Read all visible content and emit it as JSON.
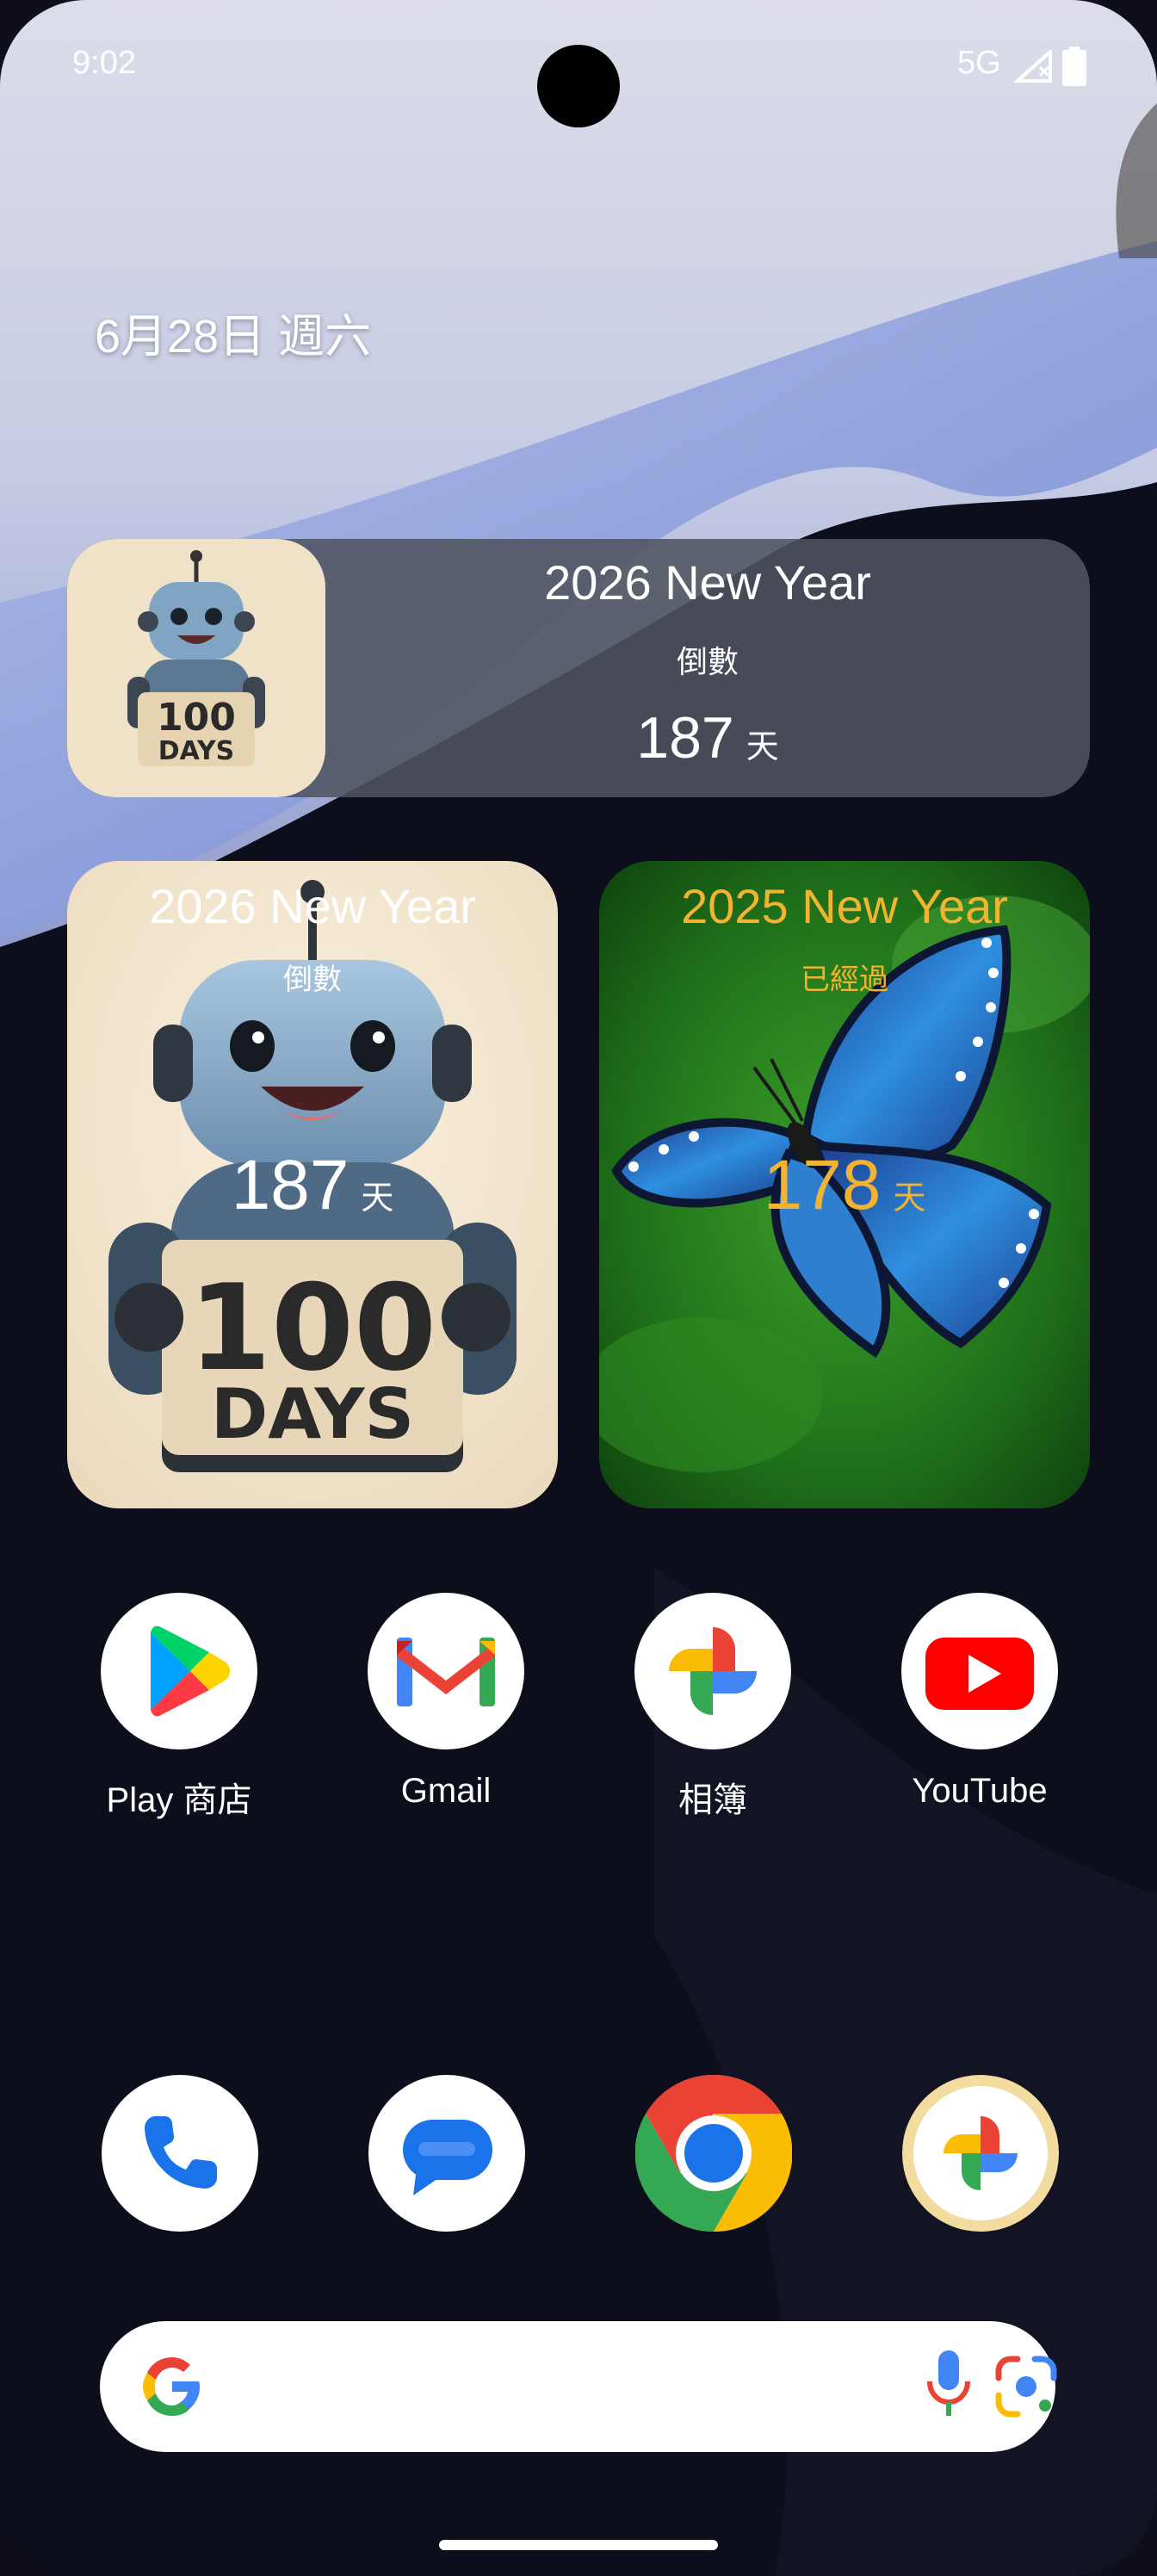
{
  "status_bar": {
    "time": "9:02",
    "network": "5G"
  },
  "date_line": "6月28日 週六",
  "wide_widget": {
    "title": "2026 New Year",
    "subtitle": "倒數",
    "count": "187",
    "unit": "天",
    "image_text": [
      "100",
      "DAYS"
    ]
  },
  "left_widget": {
    "title": "2026 New Year",
    "subtitle": "倒數",
    "count": "187",
    "unit": "天",
    "image_text": [
      "100",
      "DAYS"
    ]
  },
  "right_widget": {
    "title": "2025 New Year",
    "subtitle": "已經過",
    "count": "178",
    "unit": "天",
    "accent": "#f2b430"
  },
  "apps": [
    {
      "label": "Play 商店",
      "icon": "play-store-icon"
    },
    {
      "label": "Gmail",
      "icon": "gmail-icon"
    },
    {
      "label": "相簿",
      "icon": "photos-icon"
    },
    {
      "label": "YouTube",
      "icon": "youtube-icon"
    }
  ],
  "dock": [
    {
      "icon": "phone-icon"
    },
    {
      "icon": "messages-icon"
    },
    {
      "icon": "chrome-icon"
    },
    {
      "icon": "photos-widget-icon"
    }
  ],
  "search_bar": {
    "icons": [
      "google-g-icon",
      "microphone-icon",
      "lens-icon"
    ]
  }
}
